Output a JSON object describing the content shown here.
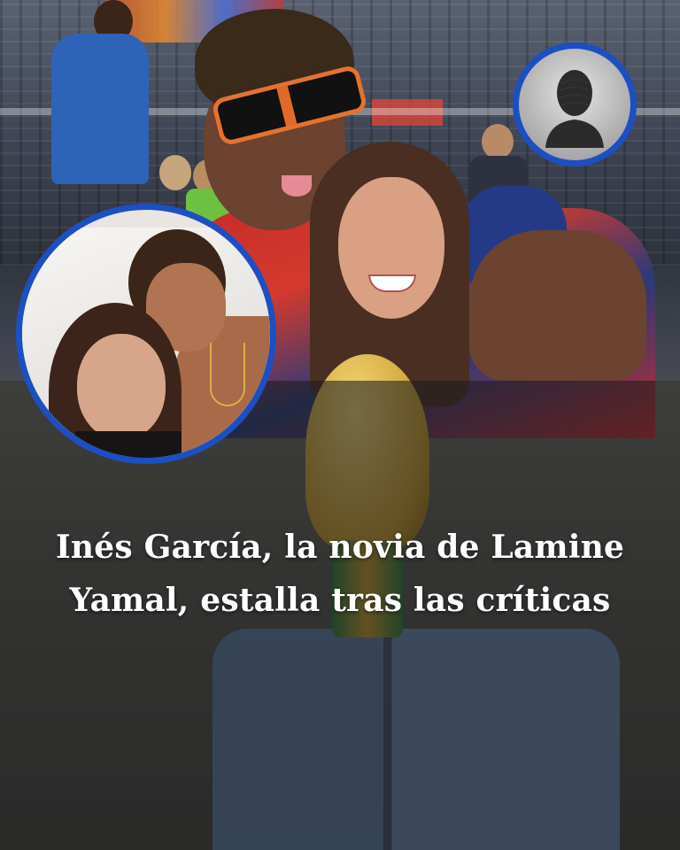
{
  "headline": {
    "line1": "Inés García, la novia de Lamine",
    "line2": "Yamal, estalla tras las críticas"
  },
  "insets": {
    "large": {
      "icon": "couple-photo"
    },
    "small": {
      "icon": "anonymous-person-silhouette-icon"
    }
  },
  "colors": {
    "circle_border": "#1d4fc2",
    "headline_text": "#ffffff",
    "overlay": "rgba(28,28,30,0.58)"
  }
}
